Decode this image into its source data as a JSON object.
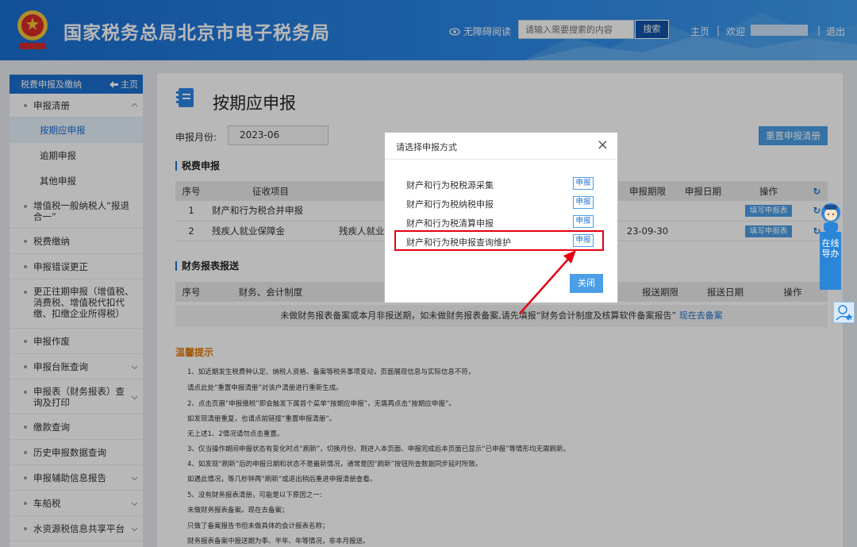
{
  "header": {
    "title": "国家税务总局北京市电子税务局",
    "accessibility": "无障碍阅读",
    "search_placeholder": "请输入需要搜索的内容",
    "search_button": "搜索",
    "home": "主页",
    "separator": "|",
    "welcome": "欢迎",
    "logout": "退出"
  },
  "sidebar": {
    "title": "税费申报及缴纳",
    "home": "主页",
    "group": "申报清册",
    "subitems": [
      "按期应申报",
      "逾期申报",
      "其他申报"
    ],
    "items": [
      "增值税一般纳税人“报退合一”",
      "税费缴纳",
      "申报错误更正",
      "更正往期申报（增值税、消费税、增值税代扣代缴、扣缴企业所得税）",
      "申报作废",
      "申报台账查询",
      "申报表（财务报表）查询及打印",
      "缴款查询",
      "历史申报数据查询",
      "申报辅助信息报告",
      "车船税",
      "水资源税信息共享平台"
    ]
  },
  "main": {
    "title": "按期应申报",
    "month_label": "申报月份:",
    "month_value": "2023-06",
    "reset_button": "重置申报清册",
    "tax_section": "税费申报",
    "tax_headers": [
      "序号",
      "征收项目",
      "申报期限",
      "申报日期",
      "操作"
    ],
    "tax_rows": [
      {
        "no": "1",
        "item": "财产和行为税合并申报",
        "detail": "",
        "deadline": "",
        "date": "",
        "action": "填写申报表"
      },
      {
        "no": "2",
        "item": "残疾人就业保障金",
        "detail": "残疾人就业",
        "deadline": "23-09-30",
        "date": "",
        "action": "填写申报表"
      }
    ],
    "fin_section": "财务报表报送",
    "fin_headers": [
      "序号",
      "财务、会计制度",
      "报送期限",
      "报送日期",
      "操作"
    ],
    "fin_note": "未做财务报表备案或本月非报送期，如未做财务报表备案,请先填报“财务会计制度及核算软件备案报告”",
    "fin_note_link": "现在去备案",
    "tips_title": "温馨提示",
    "tips": [
      "1、如近期发生税费种认定、纳税人资格、备案等税务事项变动，页面展现信息与实际信息不符，",
      "请点此处“重置申报清册”对该户清册进行重新生成。",
      "2、点击页眉“申报缴税”即会触发下属首个菜单“按期应申报”，无需再点击“按期应申报”。",
      "如发现清册重复，也请点前链接“重置申报清册”。",
      "无上述1、2情况请勿点击重置。",
      "3、仅当操作期间申报状态有变化时点“刷新”，切换月份、刚进入本页面、申报完成后本页面已显示“已申报”等情形均无需刷新。",
      "4、如发现“刷新”后的申报日期和状态不是最新情况，通常是因“刷新”按钮所查数据同步延时所致。",
      "如遇此情况，等几秒钟再“刷新”或退出稍后重进申报清册查看。",
      "5、没有财务报表清册，可能是以下原因之一:",
      "未做财务报表备案。现在去备案；",
      "只做了备案报告书但未做具体的会计报表名称；",
      "财务报表备案中报送期为季、半年、年等情况，非本月报送。"
    ]
  },
  "modal": {
    "title": "请选择申报方式",
    "options": [
      {
        "label": "财产和行为税税源采集",
        "button": "申报"
      },
      {
        "label": "财产和行为税纳税申报",
        "button": "申报"
      },
      {
        "label": "财产和行为税清算申报",
        "button": "申报"
      },
      {
        "label": "财产和行为税申报查询维护",
        "button": "申报"
      }
    ],
    "close_button": "关闭"
  },
  "float": {
    "help": "在线导办"
  },
  "colors": {
    "header_blue": "#1a6fd1",
    "primary": "#4c9fe6",
    "highlight_red": "#e60012",
    "tips_orange": "#e07a10"
  }
}
